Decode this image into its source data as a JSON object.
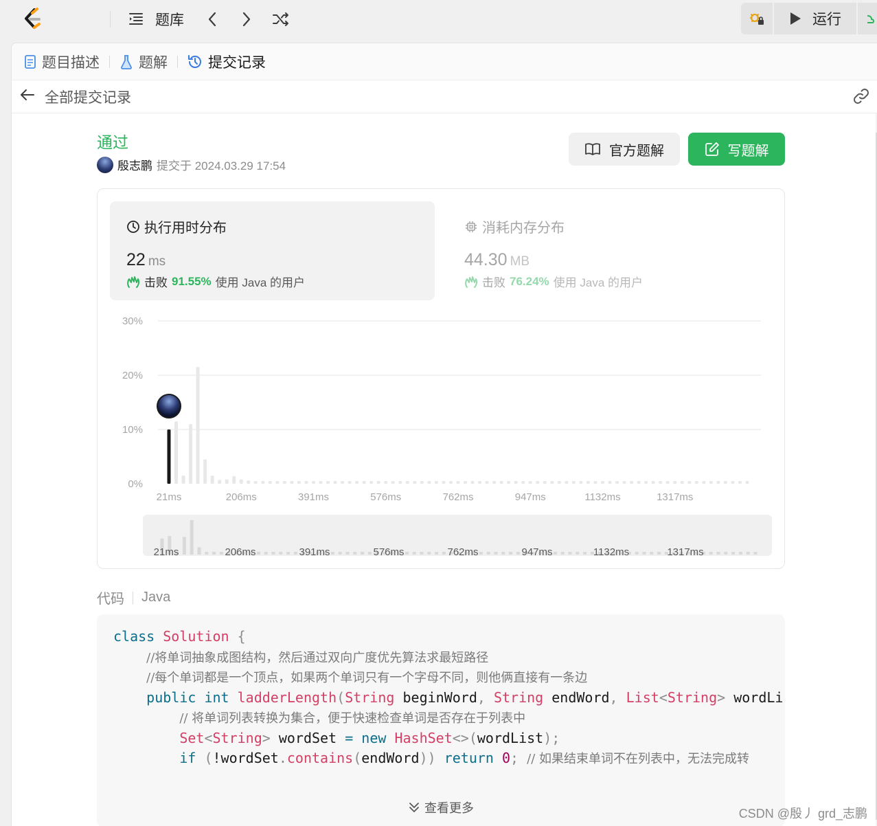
{
  "topbar": {
    "problem_bank_label": "题库",
    "run_label": "运行"
  },
  "tabs": {
    "description": "题目描述",
    "solutions": "题解",
    "submissions": "提交记录"
  },
  "subheader": {
    "back_title": "全部提交记录"
  },
  "result": {
    "status": "通过",
    "user": "殷志鹏",
    "submitted_at": "提交于 2024.03.29 17:54",
    "official_solution_button": "官方题解",
    "write_solution_button": "写题解"
  },
  "runtime": {
    "title": "执行用时分布",
    "value": "22",
    "unit": "ms",
    "beat_prefix": "击败",
    "beat_pct": "91.55%",
    "beat_suffix": "使用 Java 的用户"
  },
  "memory": {
    "title": "消耗内存分布",
    "value": "44.30",
    "unit": "MB",
    "beat_prefix": "击败",
    "beat_pct": "76.24%",
    "beat_suffix": "使用 Java 的用户"
  },
  "chart_data": {
    "type": "bar",
    "x_tick_labels": [
      "21ms",
      "206ms",
      "391ms",
      "576ms",
      "762ms",
      "947ms",
      "1132ms",
      "1317ms"
    ],
    "y_tick_labels": [
      "30%",
      "20%",
      "10%",
      "0%"
    ],
    "ylim": [
      0,
      30
    ],
    "highlight_index": 0,
    "values": [
      10,
      11.5,
      1.5,
      11,
      21.5,
      4.5,
      1.5,
      0.7,
      0.8,
      1.4,
      0.8,
      0.6,
      0.5,
      0.5,
      0.5,
      0.5,
      0.5,
      0.5,
      0.5,
      0.5,
      0.5,
      0.5,
      0.5,
      0.5,
      0.5,
      0.5,
      0.5,
      0.5,
      0.5,
      0.5,
      0.5,
      0.5,
      0.5,
      0.5,
      0.5,
      0.5,
      0.5,
      0.5,
      0.5,
      0.5,
      0.5,
      0.5,
      0.5,
      0.5,
      0.5,
      0.5,
      0.5,
      0.5,
      0.5,
      0.5,
      0.5,
      0.5,
      0.5,
      0.5,
      0.5,
      0.5,
      0.5,
      0.5,
      0.5,
      0.5,
      0.5,
      0.5,
      0.5,
      0.5,
      0.5,
      0.5,
      0.5,
      0.5,
      0.5,
      0.5,
      0.5,
      0.5,
      0.5,
      0.5,
      0.5,
      0.5,
      0.5,
      0.5,
      0.5,
      0.5,
      0.5
    ],
    "grid": true,
    "colors": {
      "highlight": "#1a1a1a",
      "bar": "#e8e8e8",
      "grid": "#e6e6e6",
      "tick": "#a6a6a6"
    }
  },
  "code": {
    "label": "代码",
    "language": "Java",
    "show_more": "查看更多",
    "lines": [
      [
        [
          "kw",
          "class"
        ],
        [
          "sp",
          " "
        ],
        [
          "cls",
          "Solution"
        ],
        [
          "sp",
          " "
        ],
        [
          "pn",
          "{"
        ]
      ],
      [
        [
          "sp",
          "    "
        ],
        [
          "cm",
          "//将单词抽象成图结构，然后通过双向广度优先算法求最短路径"
        ]
      ],
      [
        [
          "sp",
          "    "
        ],
        [
          "cm",
          "//每个单词都是一个顶点，如果两个单词只有一个字母不同，则他俩直接有一条边"
        ]
      ],
      [
        [
          "sp",
          "    "
        ],
        [
          "kw",
          "public"
        ],
        [
          "sp",
          " "
        ],
        [
          "kw",
          "int"
        ],
        [
          "sp",
          " "
        ],
        [
          "fn",
          "ladderLength"
        ],
        [
          "pn",
          "("
        ],
        [
          "cls",
          "String"
        ],
        [
          "sp",
          " "
        ],
        [
          "id",
          "beginWord"
        ],
        [
          "pn",
          ","
        ],
        [
          "sp",
          " "
        ],
        [
          "cls",
          "String"
        ],
        [
          "sp",
          " "
        ],
        [
          "id",
          "endWord"
        ],
        [
          "pn",
          ","
        ],
        [
          "sp",
          " "
        ],
        [
          "cls",
          "List"
        ],
        [
          "pn",
          "<"
        ],
        [
          "cls",
          "String"
        ],
        [
          "pn",
          ">"
        ],
        [
          "sp",
          " "
        ],
        [
          "id",
          "wordLi"
        ]
      ],
      [
        [
          "sp",
          "        "
        ],
        [
          "cm",
          "// 将单词列表转换为集合，便于快速检查单词是否存在于列表中"
        ]
      ],
      [
        [
          "sp",
          "        "
        ],
        [
          "cls",
          "Set"
        ],
        [
          "pn",
          "<"
        ],
        [
          "cls",
          "String"
        ],
        [
          "pn",
          ">"
        ],
        [
          "sp",
          " "
        ],
        [
          "id",
          "wordSet"
        ],
        [
          "sp",
          " "
        ],
        [
          "kw",
          "="
        ],
        [
          "sp",
          " "
        ],
        [
          "kw",
          "new"
        ],
        [
          "sp",
          " "
        ],
        [
          "cls",
          "HashSet"
        ],
        [
          "pn",
          "<>("
        ],
        [
          "id",
          "wordList"
        ],
        [
          "pn",
          ");"
        ]
      ],
      [
        [
          "sp",
          "        "
        ],
        [
          "kw",
          "if"
        ],
        [
          "sp",
          " "
        ],
        [
          "pn",
          "("
        ],
        [
          "id",
          "!wordSet"
        ],
        [
          "pn",
          "."
        ],
        [
          "fn",
          "contains"
        ],
        [
          "pn",
          "("
        ],
        [
          "id",
          "endWord"
        ],
        [
          "pn",
          "))"
        ],
        [
          "sp",
          " "
        ],
        [
          "kw",
          "return"
        ],
        [
          "sp",
          " "
        ],
        [
          "num",
          "0"
        ],
        [
          "pn",
          ";"
        ],
        [
          "sp",
          " "
        ],
        [
          "cm",
          "// 如果结束单词不在列表中，无法完成转"
        ]
      ]
    ]
  },
  "watermark": "CSDN @殷丿 grd_志鹏"
}
